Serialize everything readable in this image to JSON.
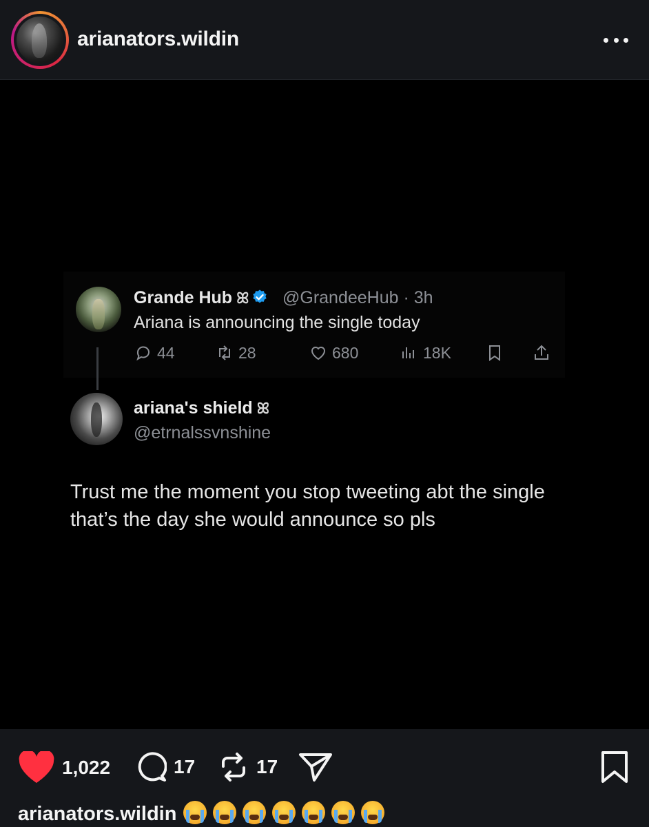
{
  "header": {
    "username": "arianators.wildin",
    "more_icon": "more-horizontal-icon"
  },
  "quoted_tweet": {
    "display_name": "Grande Hub",
    "badge_glyph": "ꕤ",
    "handle_time": "@GrandeeHub · 3h",
    "text": "Ariana is announcing the single today",
    "replies": "44",
    "retweets": "28",
    "likes": "680",
    "views": "18K",
    "icons": [
      "reply-icon",
      "retweet-icon",
      "like-icon",
      "views-icon",
      "bookmark-icon",
      "share-icon"
    ],
    "verified_color": "#1d9bf0"
  },
  "reply_tweet": {
    "display_name": "ariana's shield",
    "badge_glyph": "ꕤ",
    "handle": "@etrnalssvnshine",
    "text": "Trust me the moment you stop tweeting abt the single that’s the day she would announce so pls"
  },
  "post_actions": {
    "likes": "1,022",
    "comments": "17",
    "reposts": "17",
    "like_color": "#ff3040"
  },
  "caption": {
    "username": "arianators.wildin",
    "emojis": [
      "loudly-crying-face",
      "loudly-crying-face",
      "loudly-crying-face",
      "loudly-crying-face",
      "loudly-crying-face",
      "loudly-crying-face",
      "loudly-crying-face"
    ]
  }
}
